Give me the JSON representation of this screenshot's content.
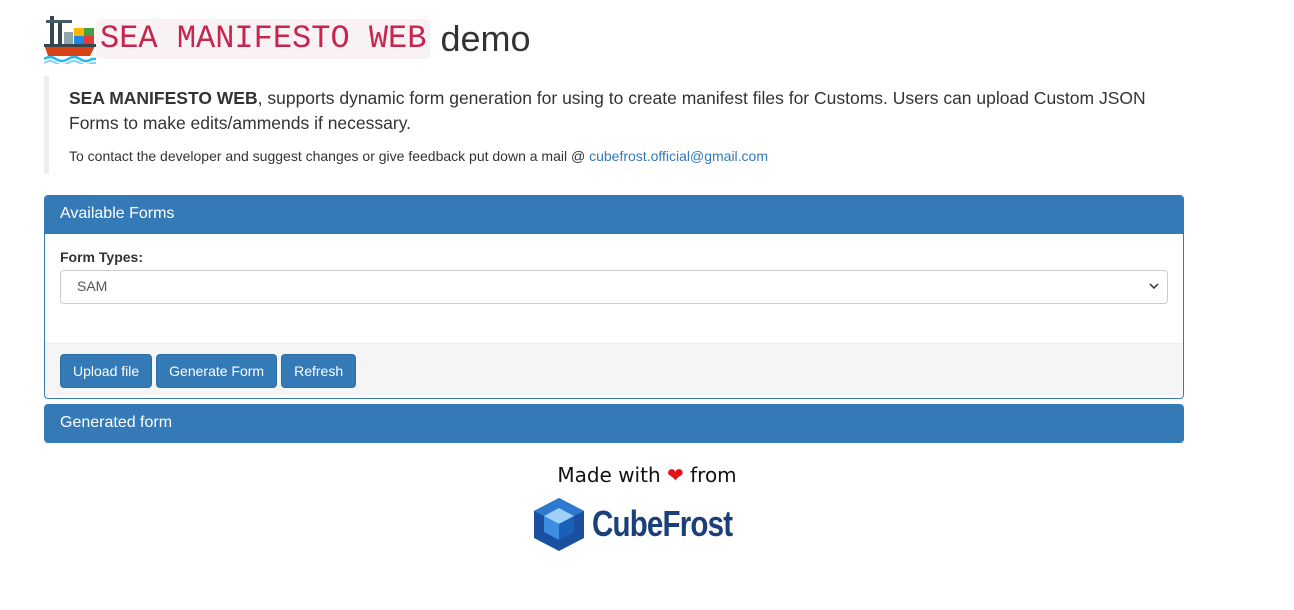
{
  "header": {
    "code_title": "SEA MANIFESTO WEB",
    "title_tail": "demo"
  },
  "intro": {
    "brand_bold": "SEA MANIFESTO WEB",
    "description": ", supports dynamic form generation for using to create manifest files for Customs. Users can upload Custom JSON Forms to make edits/ammends if necessary.",
    "contact_text": "To contact the developer and suggest changes or give feedback put down a mail @ ",
    "contact_email": "cubefrost.official@gmail.com"
  },
  "available_forms": {
    "heading": "Available Forms",
    "form_types_label": "Form Types:",
    "selected": "SAM",
    "buttons": {
      "upload": "Upload file",
      "generate": "Generate Form",
      "refresh": "Refresh"
    }
  },
  "generated_form": {
    "heading": "Generated form"
  },
  "footer": {
    "made_with": "Made with",
    "heart": "❤",
    "from": "from",
    "brand": "CubeFrost"
  },
  "colors": {
    "primary": "#337ab7",
    "code_text": "#c7254e",
    "code_bg": "#f9f2f4",
    "heart": "#e0151b",
    "brand": "#1b3f7a"
  },
  "icons": [
    "ship-icon",
    "heart-icon",
    "cubefrost-logo-icon",
    "chevron-down-icon"
  ]
}
